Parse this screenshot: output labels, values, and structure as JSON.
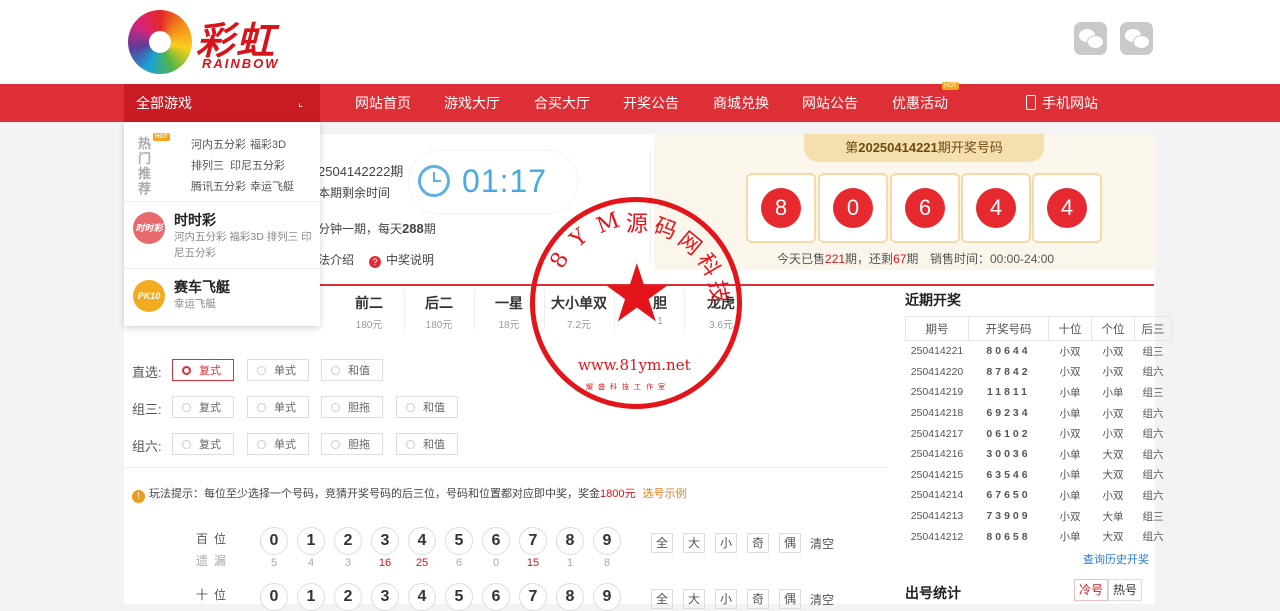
{
  "brand": {
    "name_cn": "彩虹",
    "name_en": "RAINBOW"
  },
  "social": [
    {
      "icon": "wechat-icon"
    },
    {
      "icon": "wechat-icon"
    }
  ],
  "nav": {
    "all_games": "全部游戏",
    "items": [
      "网站首页",
      "游戏大厅",
      "合买大厅",
      "开奖公告",
      "商城兑换",
      "网站公告",
      "优惠活动"
    ],
    "hot_badge": "HOT",
    "mobile": "手机网站"
  },
  "dropdown": {
    "hot_label": "热门推荐",
    "hot_badge": "HOT",
    "hot_links": [
      "河内五分彩",
      "福彩3D",
      "排列三",
      "印尼五分彩",
      "腾讯五分彩",
      "幸运飞艇"
    ],
    "categories": [
      {
        "title": "时时彩",
        "games": "河内五分彩 福彩3D 排列三 印尼五分彩",
        "icon": "时时彩",
        "color": "#e86a6e"
      },
      {
        "title": "赛车飞艇",
        "games": "幸运飞艇",
        "icon": "PK10",
        "color": "#f3ac22"
      }
    ]
  },
  "current": {
    "issue": "2504142222期",
    "remain_label": "本期剩余时间",
    "countdown": "01:17",
    "freq_text_pre": "分钟一期，每天",
    "freq_count": "288",
    "freq_unit": "期",
    "intro_link": "法介绍",
    "prize_link": "中奖说明"
  },
  "draw": {
    "title_prefix": "第",
    "issue": "20250414221",
    "title_suffix": "期开奖号码",
    "balls": [
      "8",
      "0",
      "6",
      "4",
      "4"
    ],
    "sold_pre": "今天已售",
    "sold": "221",
    "sold_mid": "期，还剩",
    "left": "67",
    "sold_suf": "期",
    "sale_time": "销售时间：00:00-24:00"
  },
  "play_tabs": [
    {
      "name": "前二",
      "price": "180元"
    },
    {
      "name": "后二",
      "price": "180元"
    },
    {
      "name": "一星",
      "price": "18元"
    },
    {
      "name": "大小单双",
      "price": "7.2元"
    },
    {
      "name": "胆",
      "price": "1"
    },
    {
      "name": "龙虎",
      "price": "3.6元"
    }
  ],
  "select_rows": [
    {
      "label": "直选:",
      "options": [
        "复式",
        "单式",
        "和值"
      ],
      "active": 0
    },
    {
      "label": "组三:",
      "options": [
        "复式",
        "单式",
        "胆拖",
        "和值"
      ],
      "active": -1
    },
    {
      "label": "组六:",
      "options": [
        "复式",
        "单式",
        "胆拖",
        "和值"
      ],
      "active": -1
    }
  ],
  "tip": {
    "label": "玩法提示：",
    "text": "每位至少选择一个号码，竞猜开奖号码的后三位，号码和位置都对应即中奖，奖金",
    "amount": "1800元",
    "link": "选号示例"
  },
  "picker": {
    "rows": [
      {
        "label": "百位",
        "miss": [
          "5",
          "4",
          "3",
          "16",
          "25",
          "6",
          "0",
          "15",
          "1",
          "8"
        ]
      },
      {
        "label": "十位",
        "miss": []
      }
    ],
    "miss_label": "遗漏",
    "digits": [
      "0",
      "1",
      "2",
      "3",
      "4",
      "5",
      "6",
      "7",
      "8",
      "9"
    ],
    "quick": [
      "全",
      "大",
      "小",
      "奇",
      "偶"
    ],
    "clear": "清空"
  },
  "recent": {
    "title": "近期开奖",
    "headers": [
      "期号",
      "开奖号码",
      "十位",
      "个位",
      "后三"
    ],
    "rows": [
      [
        "250414221",
        "80644",
        "小双",
        "小双",
        "组三"
      ],
      [
        "250414220",
        "87842",
        "小双",
        "小双",
        "组六"
      ],
      [
        "250414219",
        "11811",
        "小单",
        "小单",
        "组三"
      ],
      [
        "250414218",
        "69234",
        "小单",
        "小双",
        "组六"
      ],
      [
        "250414217",
        "06102",
        "小双",
        "小双",
        "组六"
      ],
      [
        "250414216",
        "30036",
        "小单",
        "大双",
        "组六"
      ],
      [
        "250414215",
        "63546",
        "小单",
        "大双",
        "组六"
      ],
      [
        "250414214",
        "67650",
        "小单",
        "小双",
        "组六"
      ],
      [
        "250414213",
        "73909",
        "小双",
        "大单",
        "组三"
      ],
      [
        "250414212",
        "80658",
        "小单",
        "大双",
        "组六"
      ]
    ],
    "history_link": "查询历史开奖"
  },
  "stats": {
    "title": "出号统计",
    "buttons": [
      "冷号",
      "热号"
    ]
  },
  "watermark": {
    "ring_text": "8YM源码网科技",
    "url": "www.81ym.net",
    "sub": "耀盛科技工作室"
  },
  "colors": {
    "primary_red": "#de2e36",
    "dark_red": "#c81b24",
    "timer_blue": "#4aa8df",
    "gold": "#f6dfaf"
  }
}
